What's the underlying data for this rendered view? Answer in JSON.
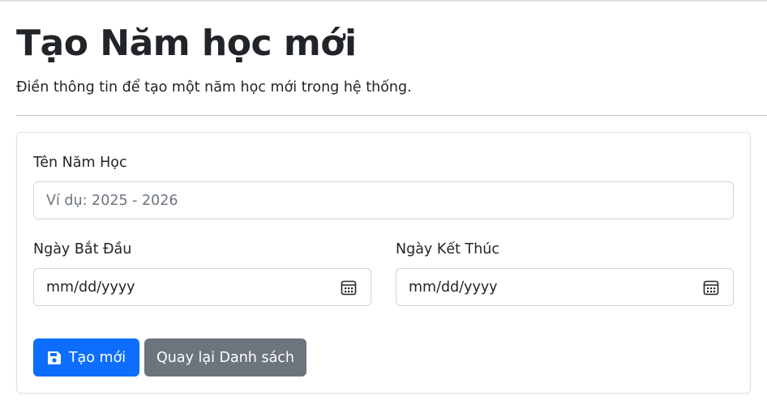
{
  "header": {
    "title": "Tạo Năm học mới",
    "subtitle": "Điền thông tin để tạo một năm học mới trong hệ thống."
  },
  "form": {
    "name_label": "Tên Năm Học",
    "name_placeholder": "Ví dụ: 2025 - 2026",
    "name_value": "",
    "start_label": "Ngày Bắt Đầu",
    "start_value": "mm/dd/yyyy",
    "end_label": "Ngày Kết Thúc",
    "end_value": "mm/dd/yyyy"
  },
  "actions": {
    "create_label": "Tạo mới",
    "back_label": "Quay lại Danh sách"
  },
  "icons": {
    "calendar": "calendar-icon",
    "save": "save-icon"
  },
  "colors": {
    "primary": "#0d6efd",
    "secondary": "#6c757d",
    "border": "#ced4da"
  }
}
